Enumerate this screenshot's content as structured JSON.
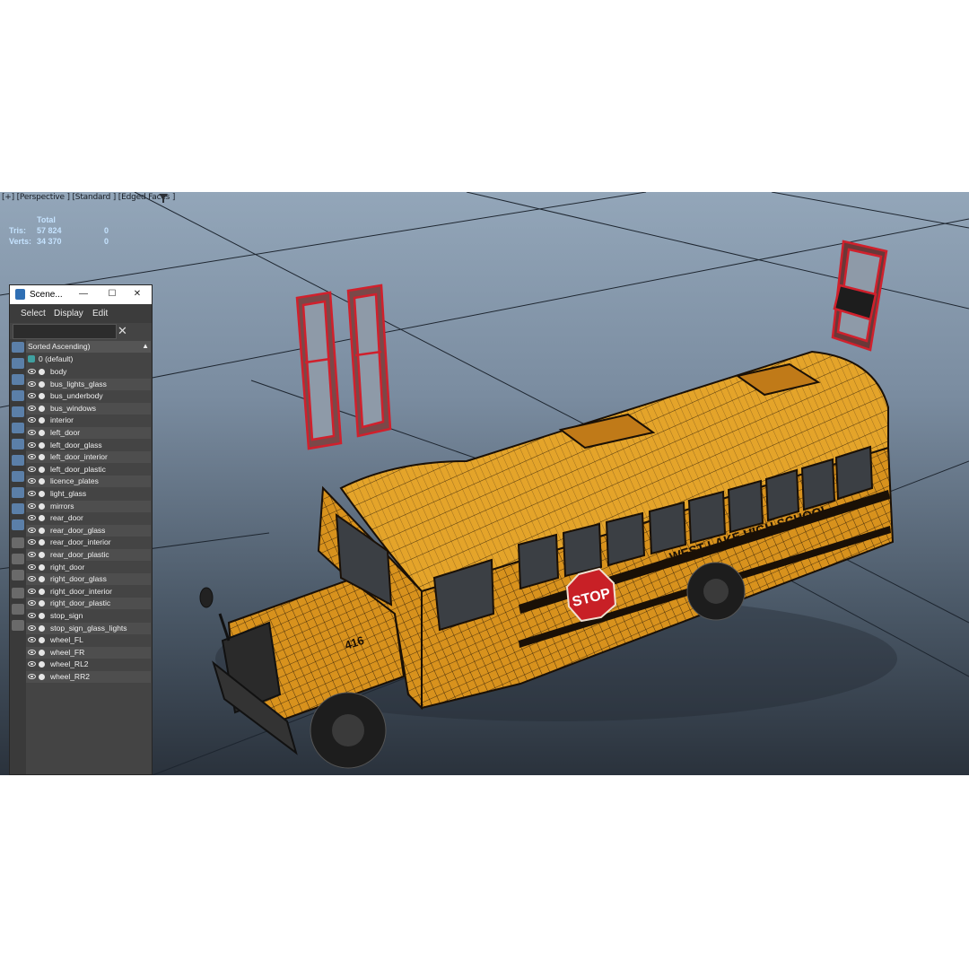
{
  "viewport": {
    "label": "[+] [Perspective ] [Standard ] [Edged Faces ]",
    "stats": {
      "header": "Total",
      "tris_label": "Tris:",
      "tris_value": "57 824",
      "tris_selected": "0",
      "verts_label": "Verts:",
      "verts_value": "34 370",
      "verts_selected": "0"
    },
    "bus": {
      "school_name": "WEST LAKE HIGH SCHOOL",
      "stop_text": "STOP",
      "number": "416"
    }
  },
  "scene_explorer": {
    "title": "Scene...",
    "window_buttons": {
      "minimize": "—",
      "maximize": "☐",
      "close": "✕"
    },
    "menu": {
      "select": "Select",
      "display": "Display",
      "edit": "Edit"
    },
    "search_clear": "✕",
    "sort_label": "Sorted Ascending)",
    "sort_arrow": "▲",
    "layer": "0 (default)",
    "items": [
      "body",
      "bus_lights_glass",
      "bus_underbody",
      "bus_windows",
      "interior",
      "left_door",
      "left_door_glass",
      "left_door_interior",
      "left_door_plastic",
      "licence_plates",
      "light_glass",
      "mirrors",
      "rear_door",
      "rear_door_glass",
      "rear_door_interior",
      "rear_door_plastic",
      "right_door",
      "right_door_glass",
      "right_door_interior",
      "right_door_plastic",
      "stop_sign",
      "stop_sign_glass_lights",
      "wheel_FL",
      "wheel_FR",
      "wheel_RL2",
      "wheel_RR2"
    ]
  },
  "colors": {
    "bus_yellow": "#e0a020",
    "selection_red": "#d0202c",
    "stats_text": "#c5e3ff",
    "panel_bg": "#444444"
  }
}
